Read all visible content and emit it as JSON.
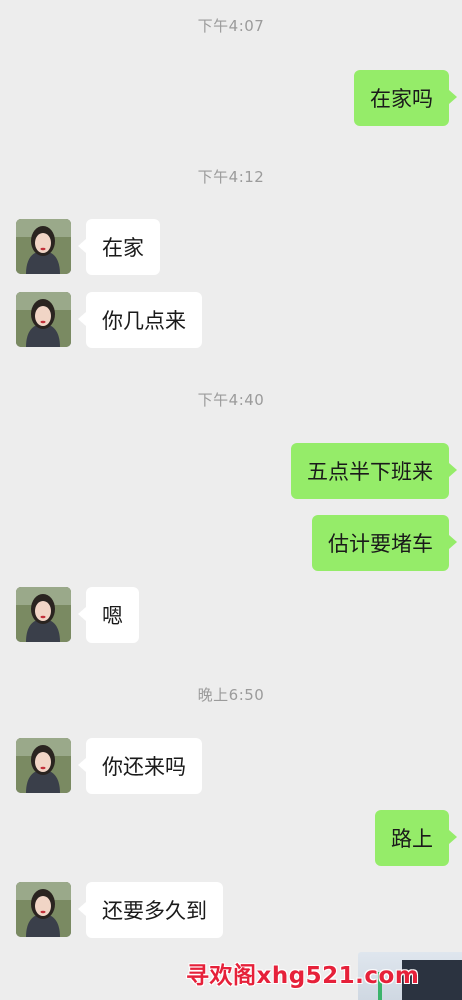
{
  "chat": {
    "messages": [
      {
        "type": "time",
        "text": "下午4:07"
      },
      {
        "type": "out",
        "text": "在家吗"
      },
      {
        "type": "time",
        "text": "下午4:12"
      },
      {
        "type": "in",
        "text": "在家"
      },
      {
        "type": "in",
        "text": "你几点来"
      },
      {
        "type": "time",
        "text": "下午4:40"
      },
      {
        "type": "out",
        "text": "五点半下班来"
      },
      {
        "type": "out",
        "text": "估计要堵车"
      },
      {
        "type": "in",
        "text": "嗯"
      },
      {
        "type": "time",
        "text": "晚上6:50"
      },
      {
        "type": "in",
        "text": "你还来吗"
      },
      {
        "type": "out",
        "text": "路上"
      },
      {
        "type": "in",
        "text": "还要多久到"
      }
    ]
  },
  "watermark": {
    "text": "寻欢阁xhg521.com"
  },
  "colors": {
    "background": "#ededed",
    "outgoing_bubble": "#95ec69",
    "incoming_bubble": "#ffffff",
    "timestamp": "#9b9b9b",
    "watermark": "#e6213a"
  }
}
